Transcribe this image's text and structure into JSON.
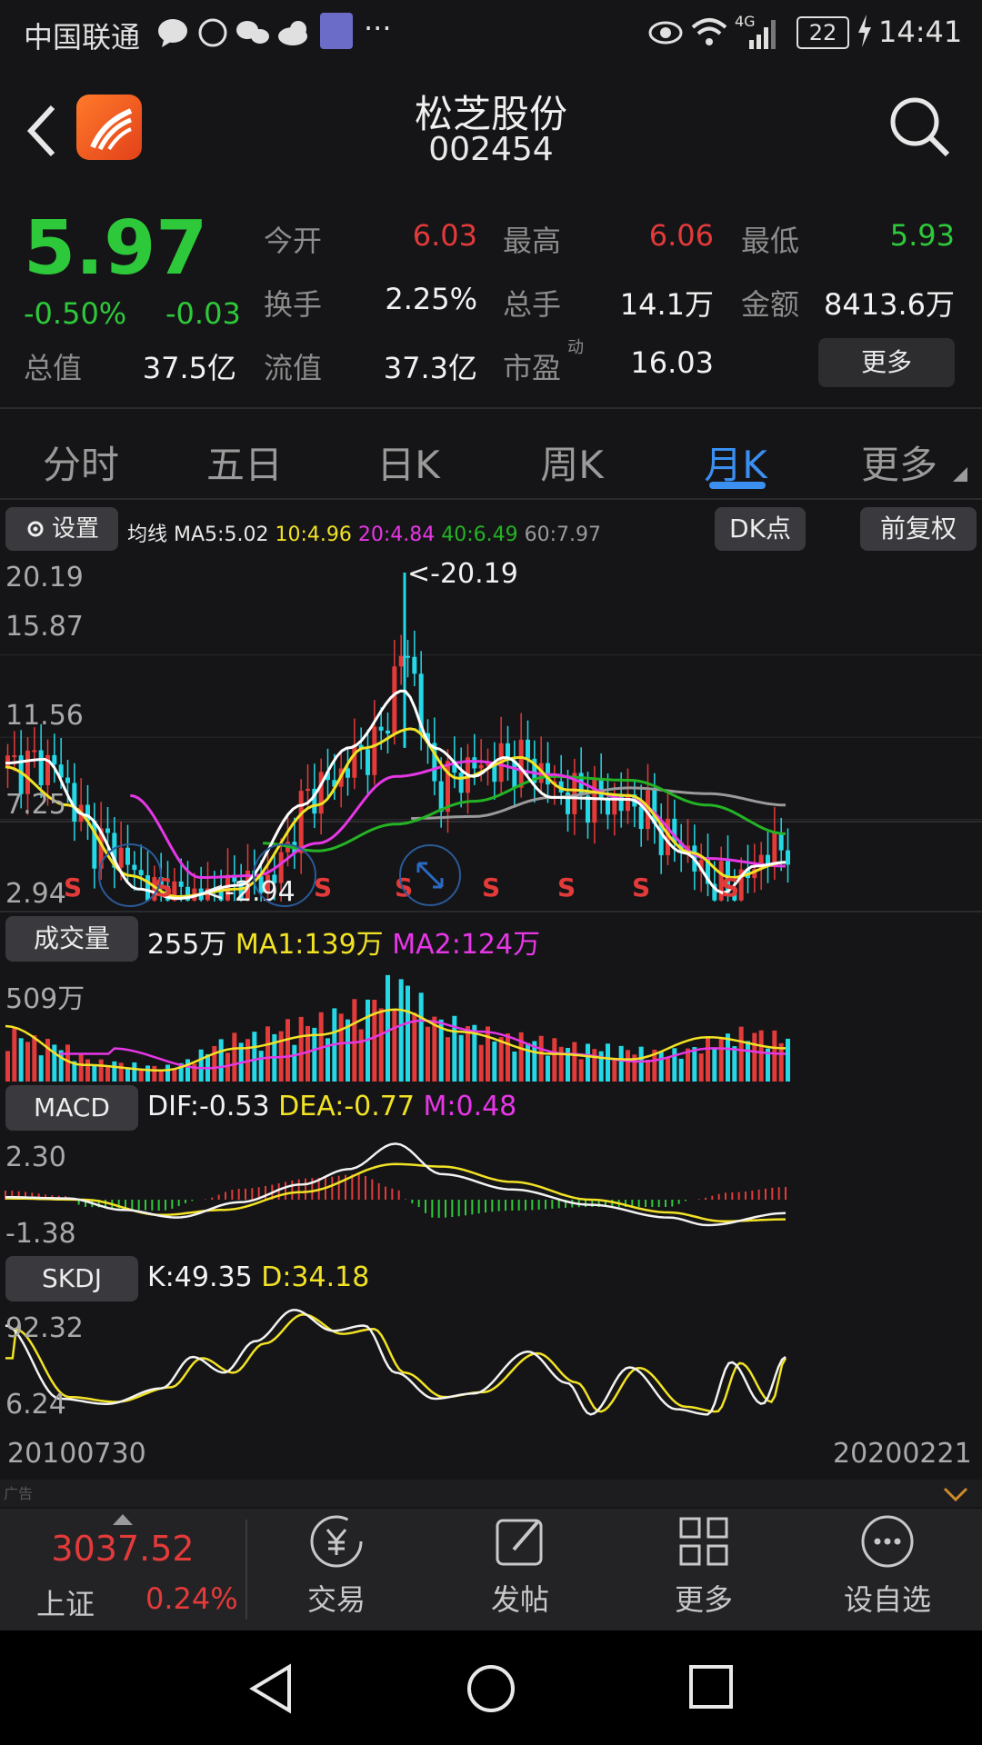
{
  "status_bar": {
    "carrier": "中国联通",
    "more": "···",
    "network": "4G",
    "battery": "22",
    "time": "14:41"
  },
  "header": {
    "title": "松芝股份",
    "code": "002454"
  },
  "quote": {
    "price": "5.97",
    "change_pct": "-0.50%",
    "change": "-0.03",
    "total_value_label": "总值",
    "total_value": "37.5亿",
    "open_label": "今开",
    "open": "6.03",
    "high_label": "最高",
    "high": "6.06",
    "low_label": "最低",
    "low": "5.93",
    "turnover_label": "换手",
    "turnover": "2.25%",
    "volume_label": "总手",
    "volume": "14.1万",
    "amount_label": "金额",
    "amount": "8413.6万",
    "float_label": "流值",
    "float_value": "37.3亿",
    "pe_label": "市盈",
    "pe_sup": "动",
    "pe": "16.03",
    "more_button": "更多"
  },
  "tabs": [
    "分时",
    "五日",
    "日K",
    "周K",
    "月K",
    "更多"
  ],
  "active_tab": "月K",
  "kline": {
    "settings_button": "设置",
    "ma_label": "均线",
    "ma5": "MA5:5.02",
    "ma10": "10:4.96",
    "ma20": "20:4.84",
    "ma40": "40:6.49",
    "ma60": "60:7.97",
    "dk_button": "DK点",
    "adjust_button": "前复权",
    "y_ticks": [
      "20.19",
      "15.87",
      "11.56",
      "7.25",
      "2.94"
    ],
    "max_marker": "<-20.19",
    "min_marker": "<-2.94",
    "signal": "S",
    "colors": {
      "up": "#e33a3a",
      "down": "#25d8e6",
      "ma5": "#ffffff",
      "ma10": "#f2e225",
      "ma20": "#e637e6",
      "ma40": "#24b324",
      "ma60": "#9a9a9a"
    }
  },
  "volume": {
    "label": "成交量",
    "value": "255万",
    "ma1": "MA1:139万",
    "ma2": "MA2:124万",
    "y_max": "509万"
  },
  "macd": {
    "label": "MACD",
    "dif": "DIF:-0.53",
    "dea": "DEA:-0.77",
    "m": "M:0.48",
    "y_top": "2.30",
    "y_bottom": "-1.38"
  },
  "skdj": {
    "label": "SKDJ",
    "k": "K:49.35",
    "d": "D:34.18",
    "y_top": "92.32",
    "y_bottom": "6.24"
  },
  "dates": {
    "start": "20100730",
    "end": "20200221"
  },
  "ad_label": "广告",
  "bottom_bar": {
    "index_value": "3037.52",
    "index_name": "上证",
    "index_change": "0.24%",
    "items": [
      "交易",
      "发帖",
      "更多",
      "设自选"
    ]
  }
}
